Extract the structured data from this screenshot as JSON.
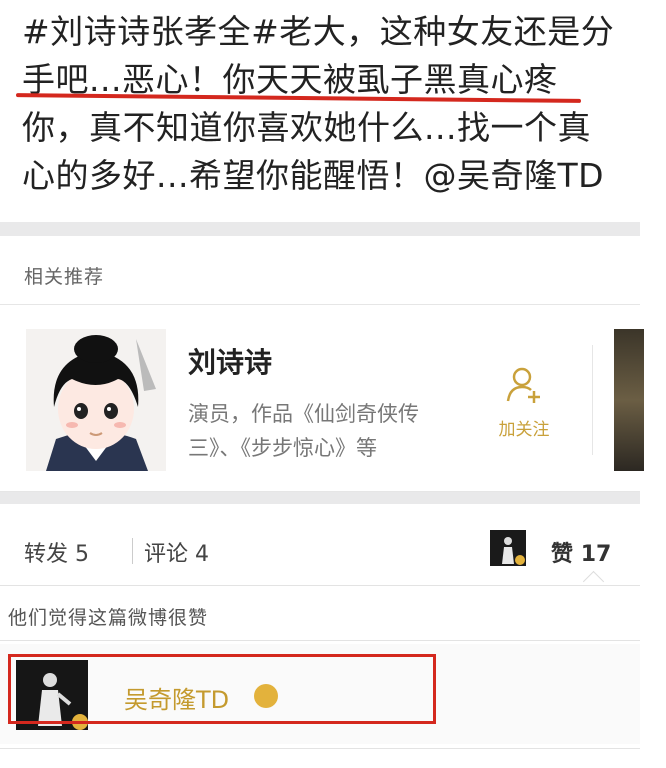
{
  "post": {
    "lines": [
      "#刘诗诗张孝全#老大，这种女友还是分",
      "手吧...恶心！你天天被虱子黑真心疼",
      "你，真不知道你喜欢她什么...找一个真",
      "心的多好...希望你能醒悟！@吴奇隆TD"
    ]
  },
  "related": {
    "label": "相关推荐",
    "card": {
      "name": "刘诗诗",
      "desc_line1": "演员，作品《仙剑奇侠传",
      "desc_line2": "三》、《步步惊心》等",
      "follow_label": "加关注",
      "avatar_icon": "anime-girl-avatar"
    }
  },
  "actions": {
    "repost_label": "转发",
    "repost_count": "5",
    "comment_label": "评论",
    "comment_count": "4",
    "like_label": "赞",
    "like_count": "17"
  },
  "likes": {
    "label": "他们觉得这篇微博很赞",
    "user_name": "吴奇隆TD"
  },
  "colors": {
    "accent_gold": "#c49a2e",
    "highlight_red": "#d4281e"
  }
}
